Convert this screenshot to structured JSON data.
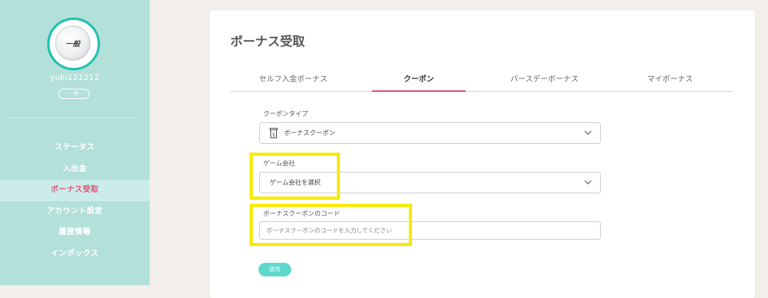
{
  "sidebar": {
    "avatar_label": "一般",
    "username": "yuki121212",
    "rank": "一般",
    "nav": [
      {
        "label": "ステータス"
      },
      {
        "label": "入出金"
      },
      {
        "label": "ボーナス受取",
        "active": true
      },
      {
        "label": "アカウント設定"
      },
      {
        "label": "履歴情報"
      },
      {
        "label": "インボックス"
      }
    ]
  },
  "main": {
    "title": "ボーナス受取",
    "tabs": [
      {
        "label": "セルフ入金ボーナス"
      },
      {
        "label": "クーポン",
        "active": true
      },
      {
        "label": "バースデーボーナス"
      },
      {
        "label": "マイボーナス"
      }
    ],
    "form": {
      "coupon_type_label": "クーポンタイプ",
      "coupon_type_value": "ボーナスクーポン",
      "game_company_label": "ゲーム会社",
      "game_company_value": "ゲーム会社を選択",
      "code_label": "ボーナスクーポンのコード",
      "code_placeholder": "ボーナスクーポンのコードを入力してください",
      "submit_label": "送信"
    }
  },
  "colors": {
    "sidebar_bg": "#b3e0d9",
    "accent_pink": "#e5517a",
    "accent_teal": "#5fd8cc",
    "highlight": "#f7ea00"
  },
  "icons": {
    "coupon_type": "coupon-icon",
    "dropdown": "chevron-down-icon"
  }
}
